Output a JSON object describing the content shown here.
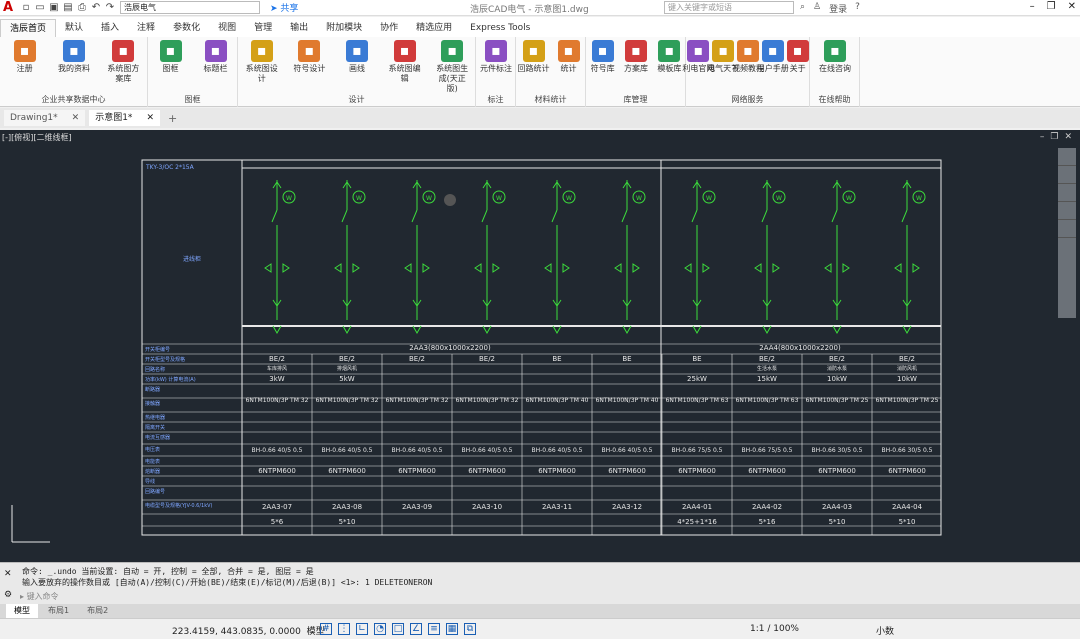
{
  "app": {
    "title": "浩辰CAD电气 - 示意图1.dwg",
    "workspace": "浩辰电气",
    "share": "共享",
    "search_placeholder": "键入关键字或短语",
    "login": "登录",
    "logo_letter": "A"
  },
  "ribbon_tabs": [
    "浩辰首页",
    "默认",
    "插入",
    "注释",
    "参数化",
    "视图",
    "管理",
    "输出",
    "附加模块",
    "协作",
    "精选应用",
    "Express Tools"
  ],
  "ribbon_groups": [
    {
      "label": "企业共享数据中心",
      "buttons": [
        "注册",
        "我的资料",
        "系统图方案库"
      ]
    },
    {
      "label": "图框",
      "buttons": [
        "图框",
        "标题栏"
      ]
    },
    {
      "label": "设计",
      "buttons": [
        "系统图设计",
        "符号设计",
        "画线",
        "系统图编辑",
        "系统图生成(天正版)"
      ]
    },
    {
      "label": "标注",
      "buttons": [
        "元件标注"
      ]
    },
    {
      "label": "材料统计",
      "buttons": [
        "回路统计",
        "统计"
      ]
    },
    {
      "label": "库管理",
      "buttons": [
        "符号库",
        "方案库",
        "模板库"
      ]
    },
    {
      "label": "网络服务",
      "buttons": [
        "利电官网",
        "电气天下",
        "视频教程",
        "用户手册",
        "关于"
      ]
    },
    {
      "label": "在线帮助",
      "buttons": [
        "在线咨询"
      ]
    }
  ],
  "doc_tabs": [
    "Drawing1*",
    "示意图1*"
  ],
  "viewport_label": "[-][俯视][二维线框]",
  "drawing": {
    "title_block": "TKY-3/OC 2*15A",
    "row_label": "进线柜",
    "cabinet_a": "2AA3(800x1000x2200)",
    "cabinet_b": "2AA4(800x1000x2200)",
    "col_codes": [
      "BE/2",
      "BE/2",
      "BE/2",
      "BE/2",
      "BE",
      "BE",
      "BE",
      "BE/2",
      "BE/2",
      "BE/2"
    ],
    "loads": [
      "车库排风",
      "排烟风机",
      "",
      "",
      "",
      "",
      "",
      "生活水泵",
      "消防水泵",
      "消防风机"
    ],
    "powers": [
      "3kW",
      "5kW",
      "",
      "",
      "",
      "",
      "25kW",
      "15kW",
      "10kW",
      "10kW"
    ],
    "breakers": [
      "6NTM100N/3P TM 32",
      "6NTM100N/3P TM 32",
      "6NTM100N/3P TM 32",
      "6NTM100N/3P TM 32",
      "6NTM100N/3P TM 40",
      "6NTM100N/3P TM 40",
      "6NTM100N/3P TM 63",
      "6NTM100N/3P TM 63",
      "6NTM100N/3P TM 25",
      "6NTM100N/3P TM 25"
    ],
    "cts": [
      "BH-0.66 40/5 0.5",
      "BH-0.66 40/5 0.5",
      "BH-0.66 40/5 0.5",
      "BH-0.66 40/5 0.5",
      "BH-0.66 40/5 0.5",
      "BH-0.66 40/5 0.5",
      "BH-0.66 75/5 0.5",
      "BH-0.66 75/5 0.5",
      "BH-0.66 30/5 0.5",
      "BH-0.66 30/5 0.5"
    ],
    "meters": [
      "6NTPM600",
      "6NTPM600",
      "6NTPM600",
      "6NTPM600",
      "6NTPM600",
      "6NTPM600",
      "6NTPM600",
      "6NTPM600",
      "6NTPM600",
      "6NTPM600"
    ],
    "circuits": [
      "2AA3-07",
      "2AA3-08",
      "2AA3-09",
      "2AA3-10",
      "2AA3-11",
      "2AA3-12",
      "2AA4-01",
      "2AA4-02",
      "2AA4-03",
      "2AA4-04"
    ],
    "cables": [
      "5*6",
      "5*10",
      "",
      "",
      "",
      "",
      "4*25+1*16",
      "5*16",
      "5*10",
      "5*10"
    ],
    "row_headers": [
      "开关柜编号",
      "开关柜型号及规格",
      "回路名称",
      "功率(kW) 计算电流(A)",
      "断路器",
      "接触器",
      "热继电器",
      "隔离开关",
      "电流互感器",
      "电压表",
      "电能表",
      "熔断器",
      "导线",
      "回路编号",
      "电缆型号及规格(YJV-0.6/1kV)"
    ]
  },
  "command": {
    "line1": "命令: _.undo 当前设置: 自动 = 开, 控制 = 全部, 合并 = 是, 图层 = 是",
    "line2": "输入要放弃的操作数目或 [自动(A)/控制(C)/开始(BE)/结束(E)/标记(M)/后退(B)] <1>: 1 DELETEONERON",
    "placeholder": "键入命令"
  },
  "layouts": [
    "模型",
    "布局1",
    "布局2"
  ],
  "status": {
    "coords": "223.4159, 443.0835, 0.0000",
    "mode": "模型",
    "zoom": "1:1 / 100%",
    "units": "小数"
  }
}
